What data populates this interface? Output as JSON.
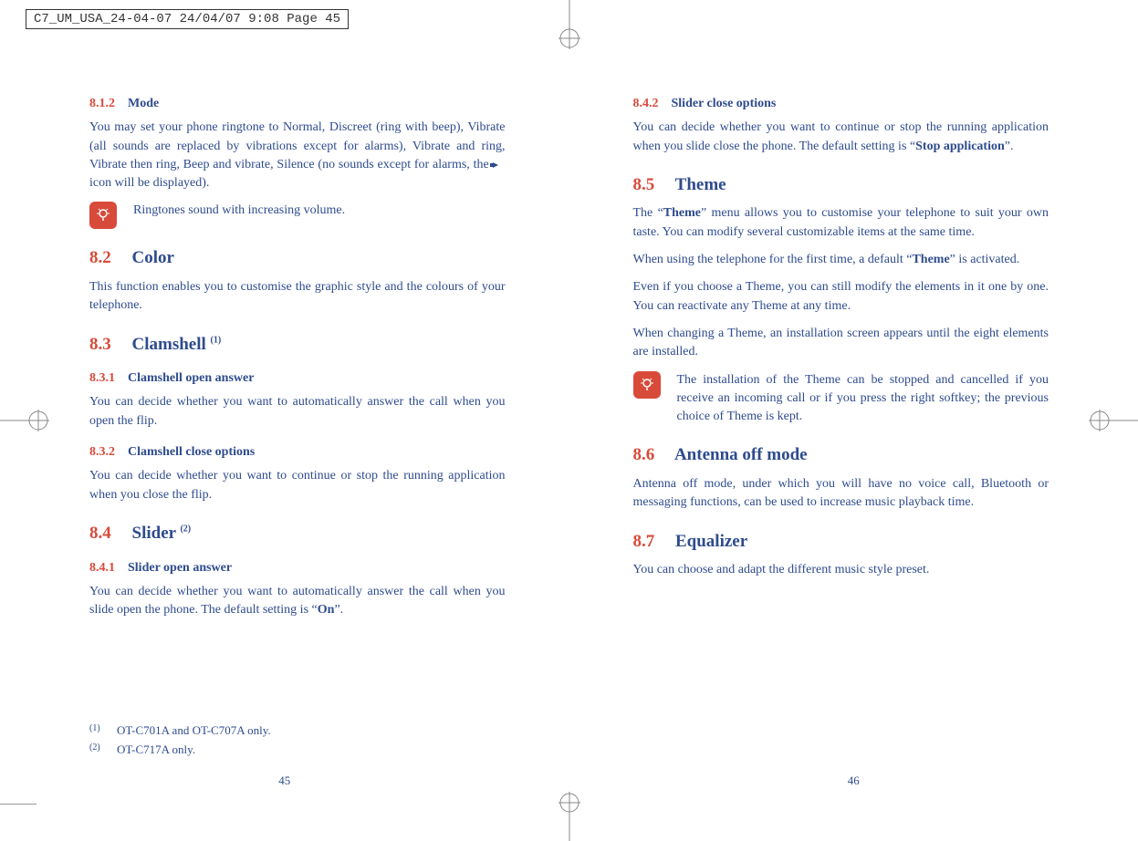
{
  "header": "C7_UM_USA_24-04-07  24/04/07  9:08  Page 45",
  "left": {
    "s812": {
      "num": "8.1.2",
      "title": "Mode",
      "p": "You may set your phone ringtone to Normal, Discreet (ring with beep), Vibrate (all sounds are replaced by vibrations except for alarms), Vibrate and ring, Vibrate then ring, Beep and vibrate, Silence (no sounds except for alarms, the ",
      "p2": " icon will be displayed)."
    },
    "tip1": "Ringtones sound with increasing volume.",
    "s82": {
      "num": "8.2",
      "title": "Color",
      "p": "This function enables you to customise the graphic style and the colours of your telephone."
    },
    "s83": {
      "num": "8.3",
      "title": "Clamshell ",
      "sup": "(1)"
    },
    "s831": {
      "num": "8.3.1",
      "title": "Clamshell open answer",
      "p": "You can decide whether you want to automatically answer the call when you open the flip."
    },
    "s832": {
      "num": "8.3.2",
      "title": "Clamshell close options",
      "p": "You can decide whether you want to continue or stop the running application when you close the flip."
    },
    "s84": {
      "num": "8.4",
      "title": "Slider ",
      "sup": "(2)"
    },
    "s841": {
      "num": "8.4.1",
      "title": "Slider open answer",
      "p1": "You can decide whether you want to automatically answer the call when you slide open the phone. The default setting is “",
      "b": "On",
      "p2": "”."
    },
    "fn1m": "(1)",
    "fn1": "OT-C701A and OT-C707A only.",
    "fn2m": "(2)",
    "fn2": "OT-C717A only.",
    "pageNum": "45"
  },
  "right": {
    "s842": {
      "num": "8.4.2",
      "title": "Slider close options",
      "p1": "You can decide whether you want to continue or stop the running application when you slide close the phone. The default setting is “",
      "b": "Stop application",
      "p2": "”."
    },
    "s85": {
      "num": "8.5",
      "title": "Theme",
      "p1a": "The “",
      "p1b": "Theme",
      "p1c": "” menu allows you to customise your telephone to suit your own taste. You can modify several customizable items at the same time.",
      "p2a": "When using the telephone for the first time, a default “",
      "p2b": "Theme",
      "p2c": "” is activated.",
      "p3": "Even if you choose a Theme, you can still modify the elements in it one by one. You can reactivate any Theme at any time.",
      "p4": "When changing a Theme, an installation screen appears until the eight elements are installed."
    },
    "tip2": "The installation of the Theme can be stopped and cancelled if you receive an incoming call or if you press the right softkey; the previous choice of Theme is kept.",
    "s86": {
      "num": "8.6",
      "title": "Antenna off mode",
      "p": "Antenna off mode, under which you will have no voice call, Bluetooth or messaging functions, can be used to increase music playback time."
    },
    "s87": {
      "num": "8.7",
      "title": "Equalizer",
      "p": "You can choose and adapt the different music style preset."
    },
    "pageNum": "46"
  }
}
